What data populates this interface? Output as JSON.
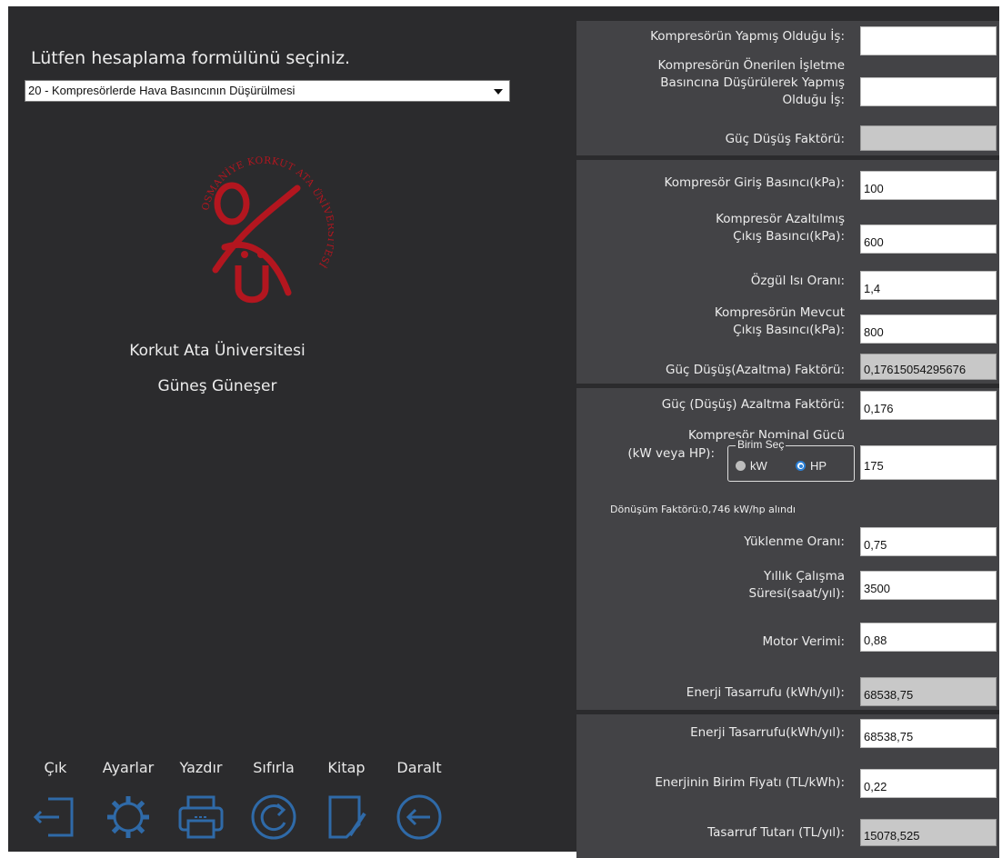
{
  "left": {
    "prompt": "Lütfen hesaplama formülünü seçiniz.",
    "formula_select": "20 - Kompresörlerde Hava Basıncının Düşürülmesi",
    "university": "Korkut Ata Üniversitesi",
    "author": "Güneş Güneşer",
    "logo_text": "OSMANİYE KORKUT ATA ÜNİVERSİTESİ"
  },
  "toolbar": {
    "items": [
      {
        "label": "Çık",
        "icon": "exit-icon"
      },
      {
        "label": "Ayarlar",
        "icon": "gear-icon"
      },
      {
        "label": "Yazdır",
        "icon": "printer-icon"
      },
      {
        "label": "Sıfırla",
        "icon": "reset-icon"
      },
      {
        "label": "Kitap",
        "icon": "book-icon"
      },
      {
        "label": "Daralt",
        "icon": "collapse-icon"
      }
    ]
  },
  "results": {
    "work_label": "Kompresörün Yapmış Olduğu İş:",
    "work_value": "",
    "reduced_work_label_1": "Kompresörün Önerilen İşletme",
    "reduced_work_label_2": "Basıncına Düşürülerek Yapmış",
    "reduced_work_label_3": "Olduğu İş:",
    "reduced_work_value": "",
    "power_drop_label": "Güç Düşüş Faktörü:",
    "power_drop_value": ""
  },
  "pressure": {
    "inlet_label": "Kompresör Giriş Basıncı(kPa):",
    "inlet_value": "100",
    "reduced_outlet_label_1": "Kompresör Azaltılmış",
    "reduced_outlet_label_2": "Çıkış Basıncı(kPa):",
    "reduced_outlet_value": "600",
    "specific_heat_label": "Özgül Isı Oranı:",
    "specific_heat_value": "1,4",
    "current_outlet_label_1": "Kompresörün Mevcut",
    "current_outlet_label_2": "Çıkış Basıncı(kPa):",
    "current_outlet_value": "800",
    "factor_label": "Güç Düşüş(Azaltma) Faktörü:",
    "factor_value": "0,17615054295676"
  },
  "energy": {
    "reduction_label": "Güç (Düşüş) Azaltma Faktörü:",
    "reduction_value": "0,176",
    "nominal_label_1": "Kompresör Nominal Gücü",
    "nominal_label_2": "(kW veya HP):",
    "nominal_value": "175",
    "unit_group_caption": "Birim Seç",
    "unit_kw": "kW",
    "unit_hp": "HP",
    "selected_unit": "HP",
    "conversion_note": "Dönüşüm Faktörü:0,746 kW/hp alındı",
    "load_label": "Yüklenme Oranı:",
    "load_value": "0,75",
    "hours_label_1": "Yıllık Çalışma",
    "hours_label_2": "Süresi(saat/yıl):",
    "hours_value": "3500",
    "efficiency_label": "Motor Verimi:",
    "efficiency_value": "0,88",
    "savings_label": "Enerji Tasarrufu (kWh/yıl):",
    "savings_value": "68538,75"
  },
  "cost": {
    "savings_label": "Enerji Tasarrufu(kWh/yıl):",
    "savings_value": "68538,75",
    "price_label": "Enerjinin Birim Fiyatı (TL/kWh):",
    "price_value": "0,22",
    "total_label": "Tasarruf Tutarı (TL/yıl):",
    "total_value": "15078,525"
  },
  "colors": {
    "background": "#2b2b2d",
    "panel": "#434346",
    "logo_red": "#b3161f",
    "icon_blue": "#2f6aa8",
    "radio_accent": "#2a7fd6"
  }
}
